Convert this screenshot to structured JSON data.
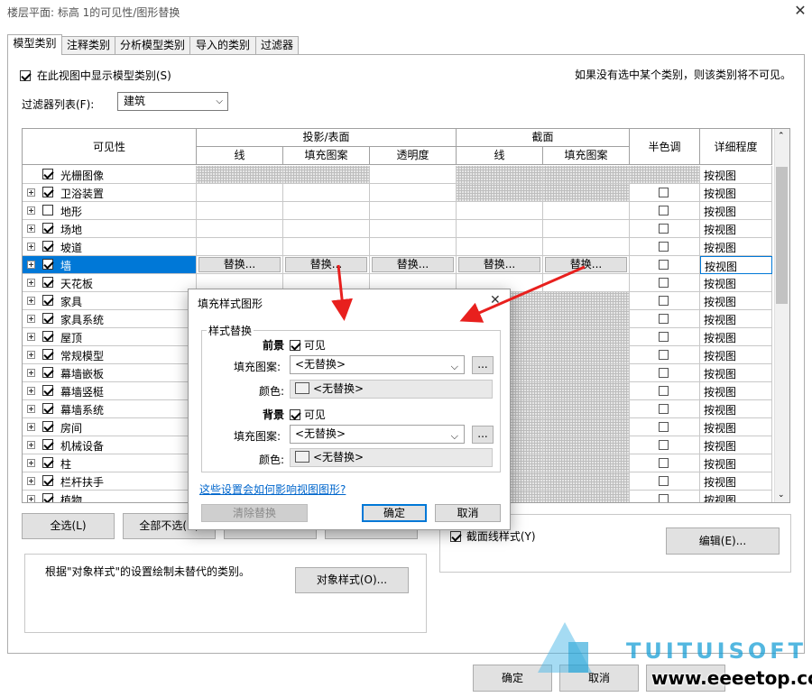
{
  "window": {
    "title": "楼层平面: 标高 1的可见性/图形替换",
    "close": "✕"
  },
  "tabs": [
    "模型类别",
    "注释类别",
    "分析模型类别",
    "导入的类别",
    "过滤器"
  ],
  "show_categories": {
    "label": "在此视图中显示模型类别(S)",
    "checked": true
  },
  "hint": "如果没有选中某个类别，则该类别将不可见。",
  "filter": {
    "label": "过滤器列表(F):",
    "value": "建筑"
  },
  "grid": {
    "headers": {
      "visibility": "可见性",
      "projection": "投影/表面",
      "cut": "截面",
      "halftone": "半色调",
      "detail": "详细程度",
      "line": "线",
      "pattern": "填充图案",
      "transparency": "透明度",
      "cut_line": "线",
      "cut_pattern": "填充图案"
    },
    "rows": [
      {
        "label": "光栅图像",
        "checked": true,
        "expand": false,
        "detail": "按视图"
      },
      {
        "label": "卫浴装置",
        "checked": true,
        "expand": true,
        "detail": "按视图"
      },
      {
        "label": "地形",
        "checked": false,
        "expand": true,
        "detail": "按视图"
      },
      {
        "label": "场地",
        "checked": true,
        "expand": true,
        "detail": "按视图"
      },
      {
        "label": "坡道",
        "checked": true,
        "expand": true,
        "detail": "按视图"
      },
      {
        "label": "墙",
        "checked": true,
        "expand": true,
        "detail": "按视图",
        "selected": true
      },
      {
        "label": "天花板",
        "checked": true,
        "expand": true,
        "detail": "按视图"
      },
      {
        "label": "家具",
        "checked": true,
        "expand": true,
        "detail": "按视图"
      },
      {
        "label": "家具系统",
        "checked": true,
        "expand": true,
        "detail": "按视图"
      },
      {
        "label": "屋顶",
        "checked": true,
        "expand": true,
        "detail": "按视图"
      },
      {
        "label": "常规模型",
        "checked": true,
        "expand": true,
        "detail": "按视图"
      },
      {
        "label": "幕墙嵌板",
        "checked": true,
        "expand": true,
        "detail": "按视图"
      },
      {
        "label": "幕墙竖梃",
        "checked": true,
        "expand": true,
        "detail": "按视图"
      },
      {
        "label": "幕墙系统",
        "checked": true,
        "expand": true,
        "detail": "按视图"
      },
      {
        "label": "房间",
        "checked": true,
        "expand": true,
        "detail": "按视图"
      },
      {
        "label": "机械设备",
        "checked": true,
        "expand": true,
        "detail": "按视图"
      },
      {
        "label": "柱",
        "checked": true,
        "expand": true,
        "detail": "按视图"
      },
      {
        "label": "栏杆扶手",
        "checked": true,
        "expand": true,
        "detail": "按视图"
      },
      {
        "label": "植物",
        "checked": true,
        "expand": true,
        "detail": "按视图"
      }
    ],
    "override_label": "替换..."
  },
  "bottom": {
    "select_all": "全选(L)",
    "select_none": "全部不选(N)",
    "note": "根据\"对象样式\"的设置绘制未替代的类别。",
    "object_styles": "对象样式(O)...",
    "cut_line_styles": "截面线样式(Y)",
    "edit": "编辑(E)...",
    "ok": "确定",
    "cancel": "取消"
  },
  "dialog": {
    "title": "填充样式图形",
    "close": "✕",
    "group": "样式替换",
    "fg_label": "前景",
    "bg_label": "背景",
    "visible": "可见",
    "pattern_label": "填充图案:",
    "color_label": "颜色:",
    "no_override": "<无替换>",
    "ellipsis": "...",
    "help_link": "这些设置会如何影响视图图形?",
    "clear": "清除替换",
    "ok": "确定",
    "cancel": "取消"
  },
  "watermark": {
    "brand": "TUITUISOFT",
    "url": "www.eeeetop.com"
  },
  "colors": {
    "accent": "#0078d7",
    "arrow": "#e8201e",
    "link": "#0066cc",
    "watermark": "#1a9fd6"
  }
}
